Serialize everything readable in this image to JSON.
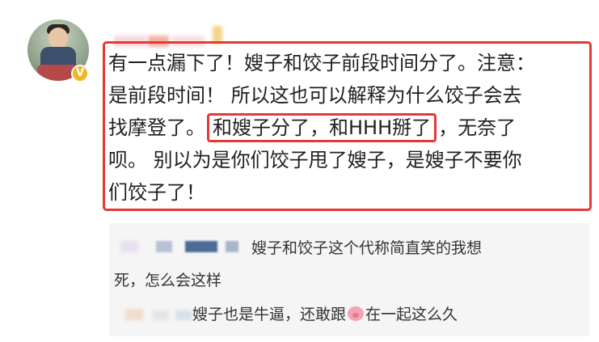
{
  "comment": {
    "avatar_badge": "V",
    "lines": [
      "有一点漏下了！嫂子和饺子前段时间分了。注意：",
      "是前段时间！ 所以这也可以解释为什么饺子会去",
      "找摩登了。",
      "，无奈了",
      "呗。 别以为是你们饺子甩了嫂子，是嫂子不要你",
      "们饺子了！"
    ],
    "highlighted_phrase": "和嫂子分了，和HHH掰了"
  },
  "replies": [
    {
      "line1": "嫂子和饺子这个代称简直笑的我想",
      "line2": "死，怎么会这样"
    },
    {
      "before_icon": "嫂子也是牛逼，还敢跟",
      "icon": "pig-emoji",
      "after_icon": "在一起这么久"
    }
  ],
  "colors": {
    "highlight_border": "#e53935",
    "badge": "#f1b526",
    "reply_background": "#f5f5f5"
  }
}
